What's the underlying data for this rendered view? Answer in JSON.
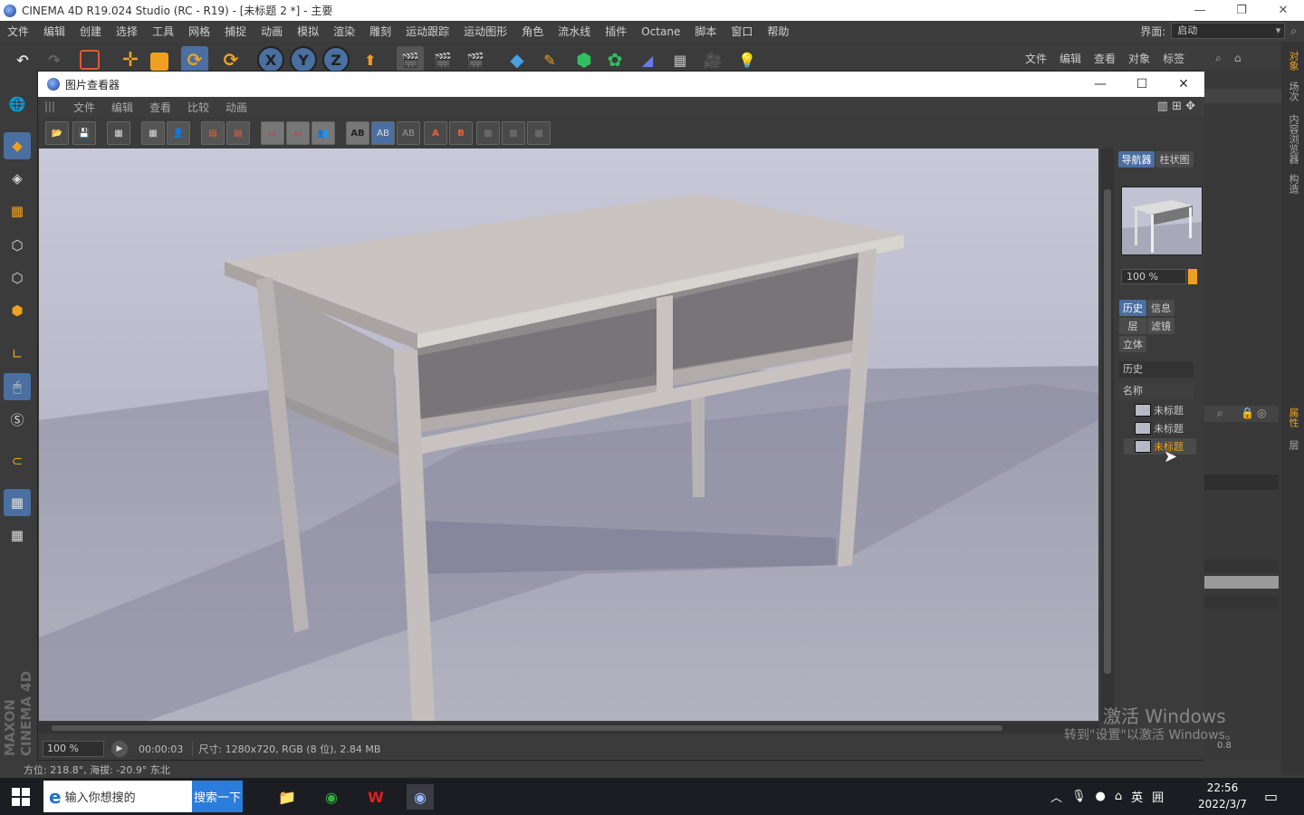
{
  "window": {
    "title": "CINEMA 4D R19.024 Studio (RC - R19) - [未标题 2 *] - 主要",
    "controls": [
      "—",
      "❐",
      "✕"
    ]
  },
  "menubar": {
    "items": [
      "文件",
      "编辑",
      "创建",
      "选择",
      "工具",
      "网格",
      "捕捉",
      "动画",
      "模拟",
      "渲染",
      "雕刻",
      "运动跟踪",
      "运动图形",
      "角色",
      "流水线",
      "插件",
      "Octane",
      "脚本",
      "窗口",
      "帮助"
    ],
    "layout_label": "界面:",
    "layout_value": "启动"
  },
  "object_manager": {
    "menu": [
      "文件",
      "编辑",
      "查看",
      "对象",
      "标签"
    ]
  },
  "right_tabs": [
    "对象",
    "场次",
    "内容浏览器",
    "构造",
    "属性",
    "层"
  ],
  "viewer": {
    "title": "图片查看器",
    "controls": [
      "—",
      "☐",
      "✕"
    ],
    "menu": [
      "文件",
      "编辑",
      "查看",
      "比较",
      "动画"
    ],
    "tool_labels": [
      "AB",
      "AB",
      "AB",
      "A",
      "B"
    ],
    "status": {
      "zoom": "100 %",
      "time": "00:00:03",
      "info": "尺寸: 1280x720, RGB (8 位), 2.84 MB"
    },
    "side": {
      "tabs_top": [
        "导航器",
        "柱状图"
      ],
      "nav_zoom": "100 %",
      "tabs_mid": [
        "历史",
        "信息",
        "层",
        "滤镜",
        "立体"
      ],
      "history_title": "历史",
      "column_name": "名称",
      "history_items": [
        {
          "label": "未标题",
          "active": false
        },
        {
          "label": "未标题",
          "active": false
        },
        {
          "label": "未标题",
          "active": true
        }
      ]
    }
  },
  "statusbar": {
    "text": "方位: 218.8°, 海拔: -20.9° 东北"
  },
  "watermark": {
    "line1": "激活 Windows",
    "line2": "转到\"设置\"以激活 Windows。"
  },
  "side_value": "0.8",
  "branding": "MAXON CINEMA 4D",
  "taskbar": {
    "search_placeholder": "输入你想搜的",
    "search_button": "搜索一下",
    "tray_lang": "英",
    "tray_grid": "囲",
    "time": "22:56",
    "date": "2022/3/7"
  },
  "colors": {
    "accent": "#4a6fa0",
    "active_history": "#f0a020",
    "taskbar_search": "#2b7ddc"
  }
}
